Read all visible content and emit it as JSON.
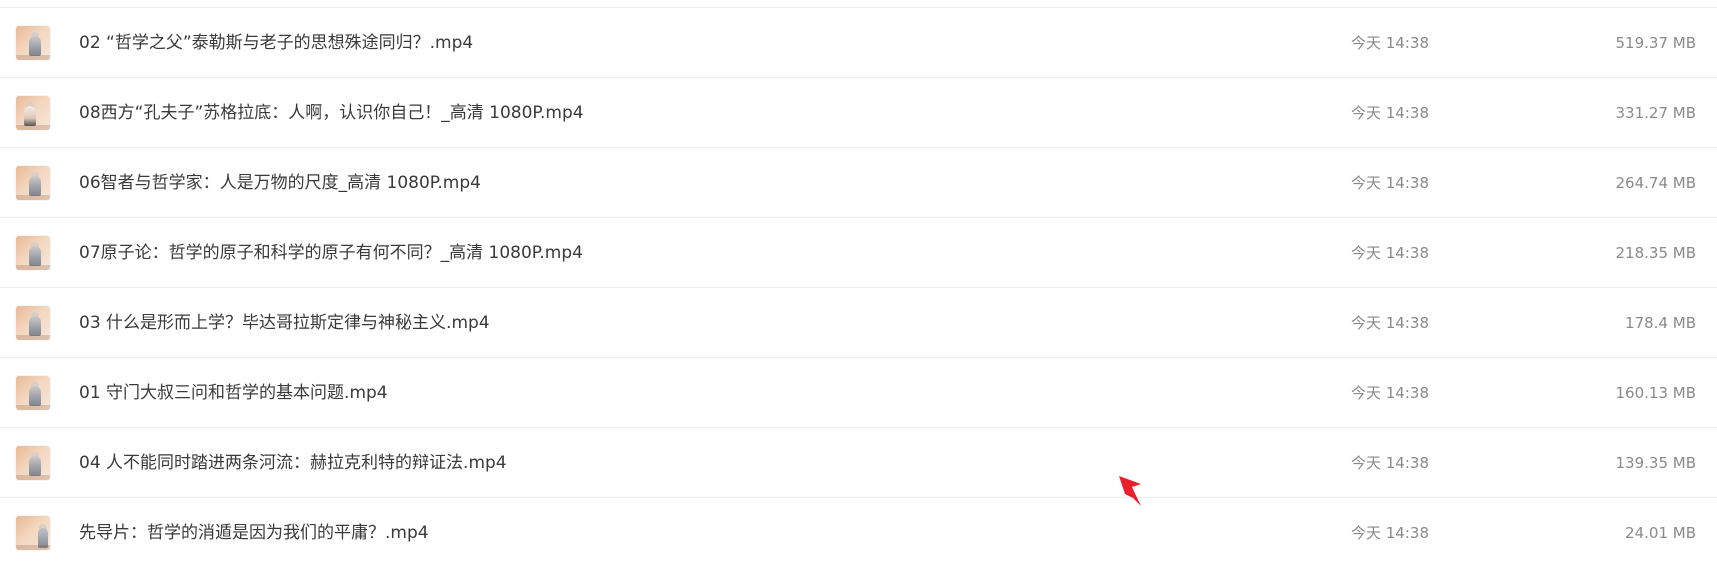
{
  "files": [
    {
      "name": "02 “哲学之父”泰勒斯与老子的思想殊途同归？.mp4",
      "time": "今天 14:38",
      "size": "519.37 MB"
    },
    {
      "name": "08西方“孔夫子”苏格拉底：人啊，认识你自己！_高清 1080P.mp4",
      "time": "今天 14:38",
      "size": "331.27 MB"
    },
    {
      "name": "06智者与哲学家：人是万物的尺度_高清 1080P.mp4",
      "time": "今天 14:38",
      "size": "264.74 MB"
    },
    {
      "name": "07原子论：哲学的原子和科学的原子有何不同？_高清 1080P.mp4",
      "time": "今天 14:38",
      "size": "218.35 MB"
    },
    {
      "name": "03 什么是形而上学？毕达哥拉斯定律与神秘主义.mp4",
      "time": "今天 14:38",
      "size": "178.4 MB"
    },
    {
      "name": "01 守门大叔三问和哲学的基本问题.mp4",
      "time": "今天 14:38",
      "size": "160.13 MB"
    },
    {
      "name": "04 人不能同时踏进两条河流：赫拉克利特的辩证法.mp4",
      "time": "今天 14:38",
      "size": "139.35 MB"
    },
    {
      "name": "先导片：哲学的消遁是因为我们的平庸？.mp4",
      "time": "今天 14:38",
      "size": "24.01 MB"
    }
  ],
  "icons": {
    "thumbnail": "video-thumbnail-icon",
    "cursor": "mouse-pointer-icon"
  },
  "colors": {
    "text": "#3a3a3a",
    "meta": "#8a8a8a",
    "divider": "#ececec",
    "cursor": "#e8202a"
  }
}
